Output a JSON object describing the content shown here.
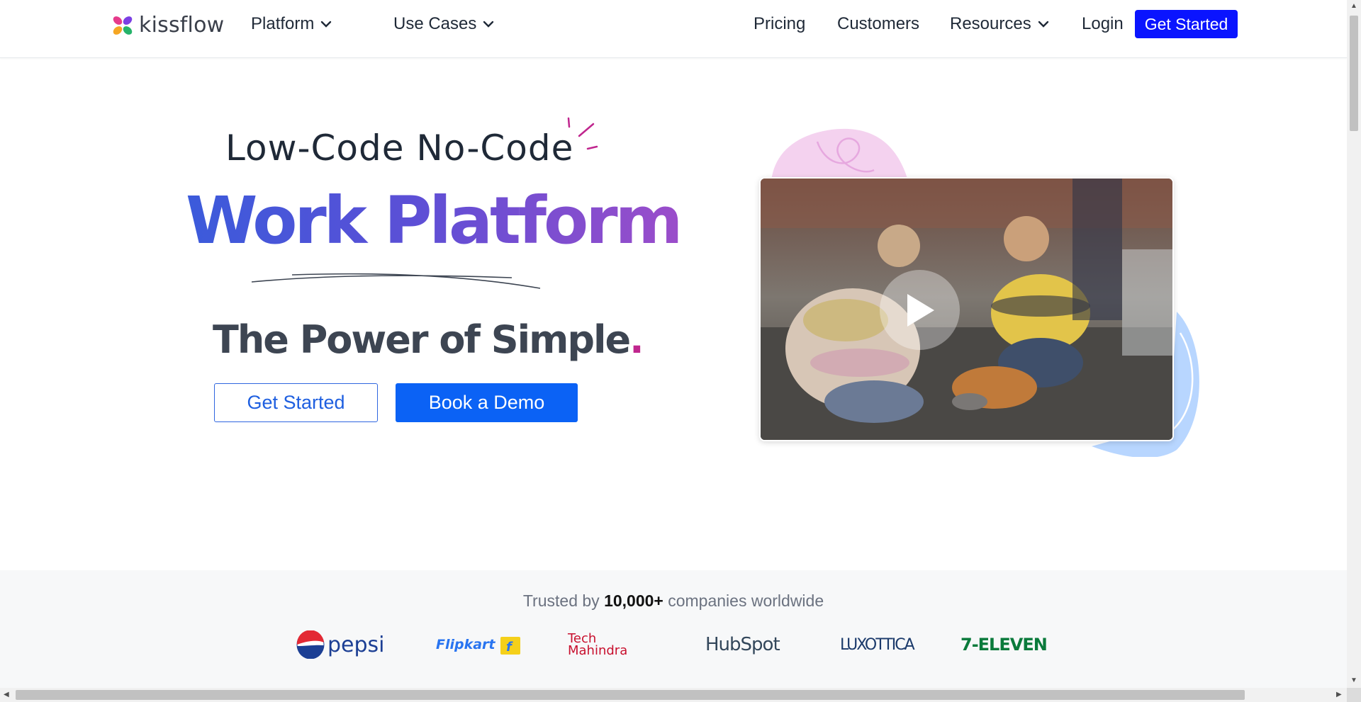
{
  "brand": {
    "name": "kissflow"
  },
  "nav": {
    "platform": "Platform",
    "use_cases": "Use Cases",
    "pricing": "Pricing",
    "customers": "Customers",
    "resources": "Resources",
    "login": "Login",
    "get_started": "Get Started"
  },
  "hero": {
    "subtitle": "Low-Code No-Code",
    "title": "Work Platform",
    "tagline": "The Power of Simple",
    "tagline_dot": ".",
    "btn_get_started": "Get Started",
    "btn_book_demo": "Book a Demo"
  },
  "trust": {
    "prefix": "Trusted by",
    "count": "10,000+",
    "suffix": "companies worldwide",
    "logos": [
      "pepsi",
      "Flipkart",
      "Tech Mahindra",
      "HubSpot",
      "LUXOTTICA",
      "7-ELEVEN"
    ]
  },
  "colors": {
    "primary": "#0b62f5",
    "nav_cta": "#0a14ff",
    "gradient_start": "#3b5bdb",
    "gradient_end": "#9b4dca",
    "accent_pink": "#c0268e"
  },
  "icons": [
    "kissflow-logo-icon",
    "chevron-down-icon",
    "play-icon"
  ]
}
